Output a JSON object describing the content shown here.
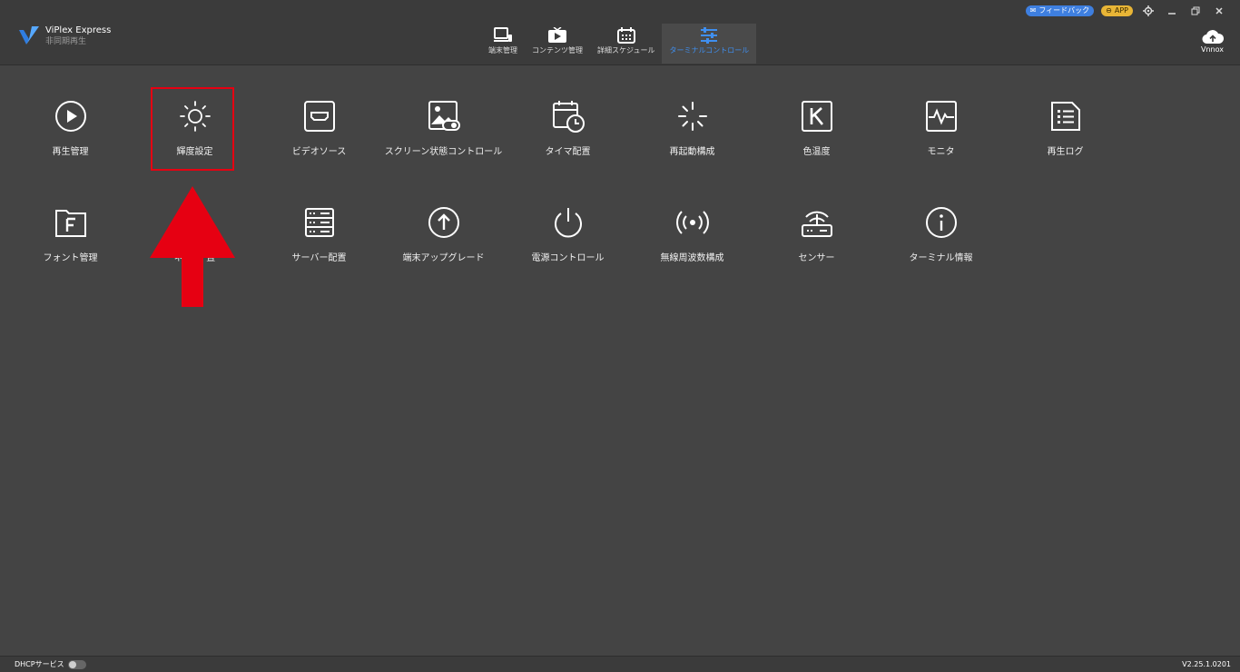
{
  "app": {
    "name": "ViPlex Express",
    "subtitle": "非同期再生"
  },
  "top_actions": {
    "feedback": "フィードバック",
    "app": "APP"
  },
  "nav": [
    {
      "label": "端末管理",
      "icon": "monitor-icon"
    },
    {
      "label": "コンテンツ管理",
      "icon": "play-tv-icon"
    },
    {
      "label": "詳細スケジュール",
      "icon": "calendar-icon"
    },
    {
      "label": "ターミナルコントロール",
      "icon": "sliders-icon",
      "active": true
    }
  ],
  "vnnox": {
    "label": "Vnnox"
  },
  "grid": {
    "row1": [
      {
        "label": "再生管理",
        "icon": "play-circle-icon"
      },
      {
        "label": "輝度設定",
        "icon": "sun-icon"
      },
      {
        "label": "ビデオソース",
        "icon": "hdmi-icon"
      },
      {
        "label": "スクリーン状態コントロール",
        "icon": "image-toggle-icon"
      },
      {
        "label": "タイマ配置",
        "icon": "timer-calendar-icon"
      },
      {
        "label": "再起動構成",
        "icon": "loading-spinner-icon"
      },
      {
        "label": "色温度",
        "icon": "k-box-icon"
      },
      {
        "label": "モニタ",
        "icon": "pulse-icon"
      },
      {
        "label": "再生ログ",
        "icon": "list-document-icon"
      }
    ],
    "row2": [
      {
        "label": "フォント管理",
        "icon": "font-folder-icon"
      },
      {
        "label": "",
        "icon": "hidden-icon"
      },
      {
        "label": "サーバー配置",
        "icon": "server-icon"
      },
      {
        "label": "端末アップグレード",
        "icon": "upgrade-arrow-icon"
      },
      {
        "label": "電源コントロール",
        "icon": "power-icon"
      },
      {
        "label": "無線周波数構成",
        "icon": "radio-wave-icon"
      },
      {
        "label": "センサー",
        "icon": "router-icon"
      },
      {
        "label": "ターミナル情報",
        "icon": "info-icon"
      }
    ]
  },
  "annotation": {
    "label_fragment": "ネ",
    "label_fragment2": "置"
  },
  "status": {
    "dhcp": "DHCPサービス",
    "dhcp_on": false,
    "version": "V2.25.1.0201"
  },
  "colors": {
    "accent": "#3f8ff0",
    "highlight": "#e60012",
    "background": "#444444"
  }
}
